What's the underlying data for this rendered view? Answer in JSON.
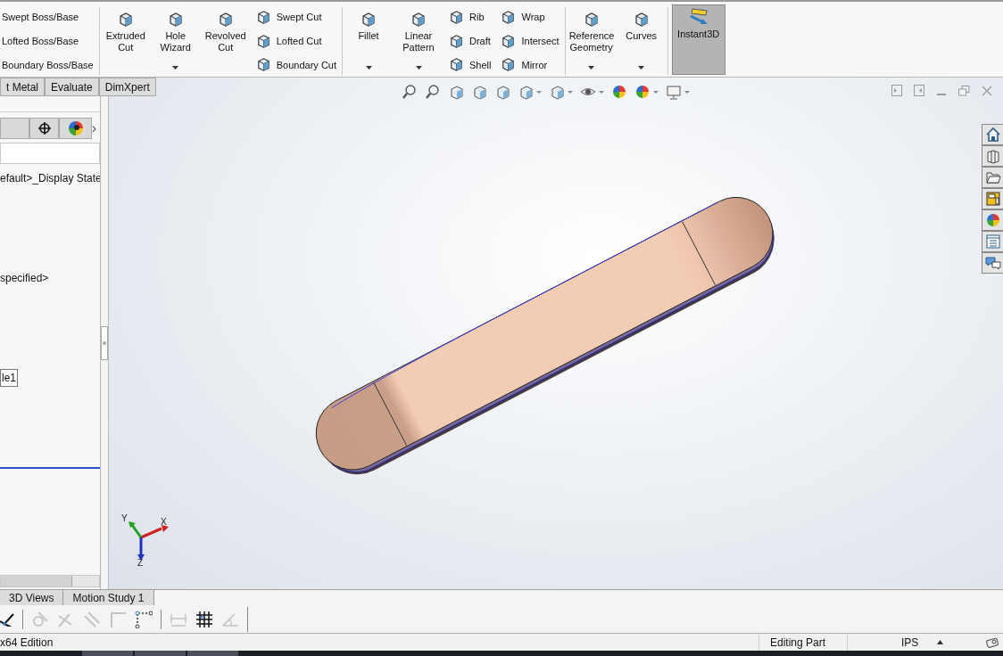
{
  "ribbon": {
    "sections": [
      {
        "items": [
          {
            "kind": "stack",
            "labels": [
              "Swept Boss/Base",
              "Lofted Boss/Base",
              "Boundary Boss/Base"
            ],
            "icons": false
          }
        ]
      },
      {
        "items": [
          {
            "kind": "large",
            "label": "Extruded Cut",
            "dropdown": false,
            "on": false
          },
          {
            "kind": "large",
            "label": "Hole Wizard",
            "dropdown": true,
            "on": false
          },
          {
            "kind": "large",
            "label": "Revolved Cut",
            "dropdown": false,
            "on": false
          },
          {
            "kind": "stack",
            "labels": [
              "Swept Cut",
              "Lofted Cut",
              "Boundary Cut"
            ],
            "icons": true
          }
        ]
      },
      {
        "items": [
          {
            "kind": "large",
            "label": "Fillet",
            "dropdown": true,
            "on": false
          },
          {
            "kind": "large",
            "label": "Linear Pattern",
            "dropdown": true,
            "on": false
          },
          {
            "kind": "stack",
            "labels": [
              "Rib",
              "Draft",
              "Shell"
            ],
            "icons": true
          },
          {
            "kind": "stack",
            "labels": [
              "Wrap",
              "Intersect",
              "Mirror"
            ],
            "icons": true
          }
        ]
      },
      {
        "items": [
          {
            "kind": "large",
            "label": "Reference Geometry",
            "dropdown": true,
            "on": false
          },
          {
            "kind": "large",
            "label": "Curves",
            "dropdown": true,
            "on": false
          }
        ]
      },
      {
        "items": [
          {
            "kind": "large",
            "label": "Instant3D",
            "dropdown": false,
            "on": true
          }
        ]
      }
    ]
  },
  "command_tabs": [
    {
      "label": "t Metal",
      "selected": false
    },
    {
      "label": "Evaluate",
      "selected": false
    },
    {
      "label": "DimXpert",
      "selected": false
    }
  ],
  "left_panel": {
    "more_tabs": "›",
    "tree": [
      {
        "kind": "plain",
        "label": "efault>_Display State"
      },
      {
        "kind": "plain",
        "label": "specified>"
      },
      {
        "kind": "boxed",
        "label": "le1"
      }
    ]
  },
  "triad": {
    "x": "X",
    "y": "Y",
    "z": "Z"
  },
  "bottom_tabs": [
    {
      "label": "3D Views",
      "selected": false
    },
    {
      "label": "Motion Study 1",
      "selected": false
    }
  ],
  "status_bar": {
    "edition": "x64 Edition",
    "mode": "Editing Part",
    "units": "IPS"
  }
}
